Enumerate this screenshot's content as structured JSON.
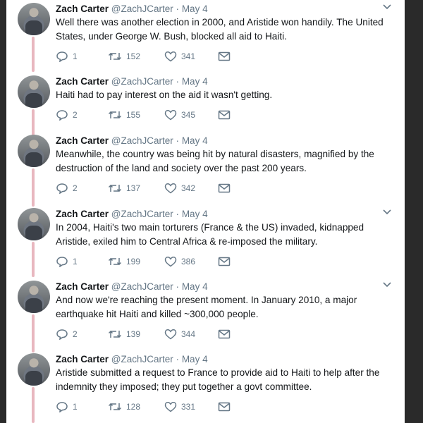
{
  "tweets": [
    {
      "name": "Zach Carter",
      "handle": "@ZachJCarter",
      "separator": "·",
      "date": "May 4",
      "text": "Well there was another election in 2000, and Aristide won handily. The United States, under George W. Bush, blocked all aid to Haiti.",
      "replies": "1",
      "retweets": "152",
      "likes": "341"
    },
    {
      "name": "Zach Carter",
      "handle": "@ZachJCarter",
      "separator": "·",
      "date": "May 4",
      "text": "Haiti had to pay interest on the aid it wasn't getting.",
      "replies": "2",
      "retweets": "155",
      "likes": "345"
    },
    {
      "name": "Zach Carter",
      "handle": "@ZachJCarter",
      "separator": "·",
      "date": "May 4",
      "text": "Meanwhile, the country was being hit by natural disasters, magnified by the destruction of the land and society over the past 200 years.",
      "replies": "2",
      "retweets": "137",
      "likes": "342"
    },
    {
      "name": "Zach Carter",
      "handle": "@ZachJCarter",
      "separator": "·",
      "date": "May 4",
      "text": "In 2004, Haiti's two main torturers (France & the US) invaded, kidnapped Aristide, exiled him to Central Africa & re-imposed the military.",
      "replies": "1",
      "retweets": "199",
      "likes": "386"
    },
    {
      "name": "Zach Carter",
      "handle": "@ZachJCarter",
      "separator": "·",
      "date": "May 4",
      "text": "And now we're reaching the present moment. In January 2010, a major earthquake hit Haiti and killed ~300,000 people.",
      "replies": "2",
      "retweets": "139",
      "likes": "344"
    },
    {
      "name": "Zach Carter",
      "handle": "@ZachJCarter",
      "separator": "·",
      "date": "May 4",
      "text": "Aristide submitted a request to France to provide aid to Haiti to help after the indemnity they imposed; they put together a govt committee.",
      "replies": "1",
      "retweets": "128",
      "likes": "331"
    }
  ],
  "colors": {
    "thread_line": "#e8b7bf",
    "text_primary": "#14171a",
    "text_secondary": "#657786"
  },
  "icons": {
    "reply": "reply-icon",
    "retweet": "retweet-icon",
    "like": "heart-icon",
    "dm": "envelope-icon",
    "more": "chevron-down-icon"
  }
}
